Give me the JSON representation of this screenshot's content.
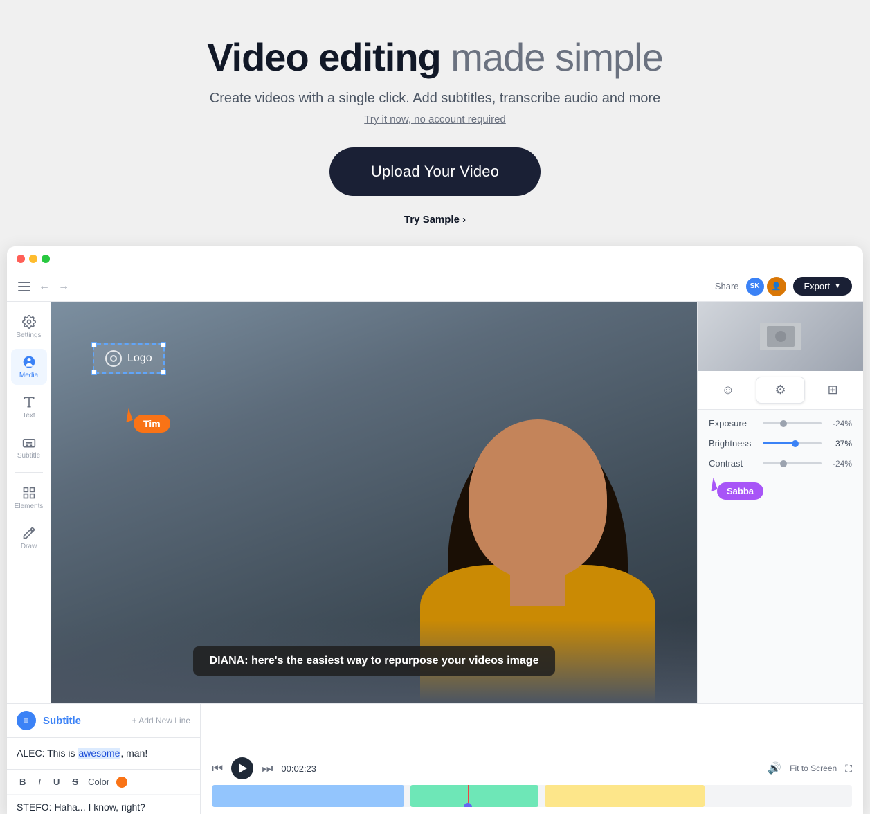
{
  "hero": {
    "title_bold": "Video editing",
    "title_light": " made simple",
    "subtitle": "Create videos with a single click. Add subtitles, transcribe audio and more",
    "tagline": "Try it now, no account required",
    "upload_btn": "Upload Your Video",
    "try_sample": "Try Sample"
  },
  "toolbar": {
    "share_label": "Share",
    "user_initials": "SK",
    "export_label": "Export"
  },
  "sidebar": {
    "items": [
      {
        "label": "Settings",
        "active": false
      },
      {
        "label": "Media",
        "active": true
      },
      {
        "label": "Text",
        "active": false
      },
      {
        "label": "Subtitle",
        "active": false
      },
      {
        "label": "Elements",
        "active": false
      },
      {
        "label": "Draw",
        "active": false
      }
    ]
  },
  "video": {
    "logo_text": "Logo",
    "tim_label": "Tim",
    "subtitle_text": "DIANA: here's the easiest way to repurpose your videos image"
  },
  "adjustments": {
    "exposure_label": "Exposure",
    "exposure_value": "-24%",
    "brightness_label": "Brightness",
    "brightness_value": "37%",
    "contrast_label": "Contrast",
    "contrast_value": "-24%",
    "sabba_label": "Sabba"
  },
  "subtitle_panel": {
    "title": "Subtitle",
    "add_line": "+ Add New Line",
    "line1": "ALEC: This is awesome, man!",
    "line1_highlight": "awesome",
    "format_color_label": "Color",
    "line2": "STEFO: Haha... I know, right?"
  },
  "playback": {
    "time": "00:02:23",
    "fit_screen": "Fit to Screen",
    "volume_icon": "🔊"
  }
}
